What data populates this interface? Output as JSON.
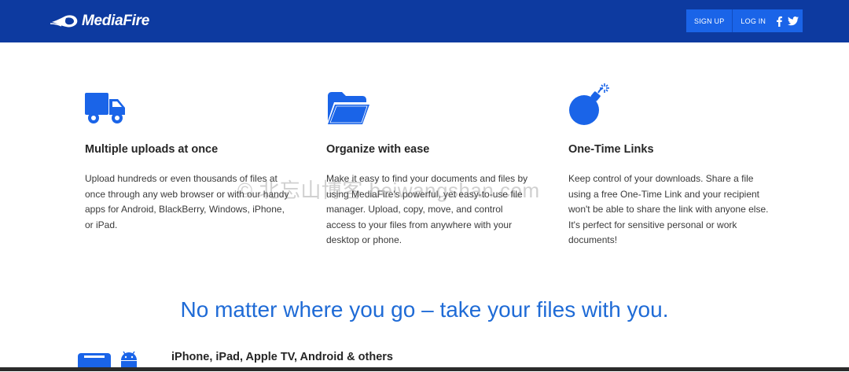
{
  "header": {
    "brand": "MediaFire",
    "sign_up_label": "SIGN UP",
    "log_in_label": "LOG IN",
    "social": [
      "facebook-icon",
      "twitter-icon"
    ],
    "colors": {
      "bar": "#0d3aa0",
      "auth_bg": "#1a64e8"
    }
  },
  "features": [
    {
      "icon": "truck-icon",
      "title": "Multiple uploads at once",
      "body": "Upload hundreds or even thousands of files at once through any web browser or with our handy apps for Android, BlackBerry, Windows, iPhone, or iPad."
    },
    {
      "icon": "folder-icon",
      "title": "Organize with ease",
      "body": "Make it easy to find your documents and files by using MediaFire's powerful, yet easy-to-use file manager. Upload, copy, move, and control access to your files from anywhere with your desktop or phone."
    },
    {
      "icon": "bomb-icon",
      "title": "One-Time Links",
      "body": "Keep control of your downloads. Share a file using a free One-Time Link and your recipient won't be able to share the link with anyone else. It's perfect for sensitive personal or work documents!"
    }
  ],
  "watermark": "© 北忘山博客 beiwangshan.com",
  "headline": "No matter where you go – take your files with you.",
  "devices": {
    "label": "iPhone, iPad, Apple TV, Android & others",
    "icons": [
      "tablet-icon",
      "android-icon"
    ]
  },
  "accent_color": "#1f6bd6"
}
